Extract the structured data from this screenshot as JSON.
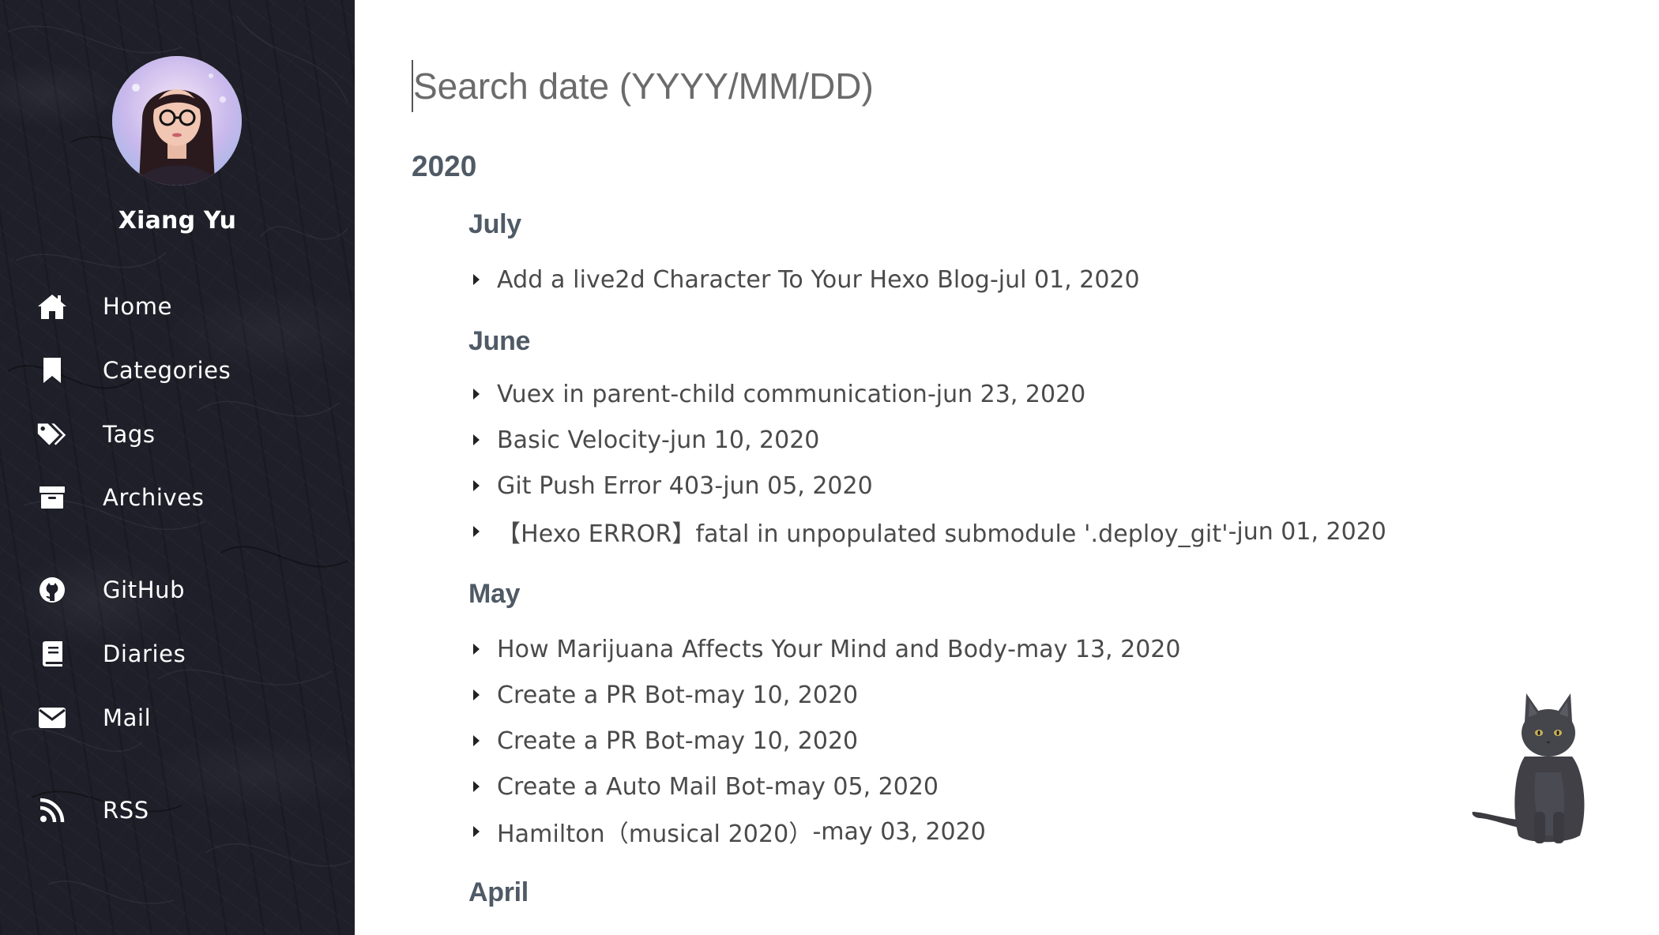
{
  "sidebar": {
    "author": "Xiang Yu",
    "nav": [
      {
        "label": "Home",
        "icon": "home-icon"
      },
      {
        "label": "Categories",
        "icon": "bookmark-icon"
      },
      {
        "label": "Tags",
        "icon": "tags-icon"
      },
      {
        "label": "Archives",
        "icon": "archive-icon"
      },
      {
        "label": "GitHub",
        "icon": "github-icon"
      },
      {
        "label": "Diaries",
        "icon": "book-icon"
      },
      {
        "label": "Mail",
        "icon": "mail-icon"
      },
      {
        "label": "RSS",
        "icon": "rss-icon"
      }
    ]
  },
  "search": {
    "placeholder": "Search date (YYYY/MM/DD)",
    "value": ""
  },
  "archive": {
    "year": "2020",
    "months": [
      {
        "name": "July",
        "posts": [
          {
            "title": "Add a live2d Character To Your Hexo Blog",
            "date": "jul 01, 2020"
          }
        ]
      },
      {
        "name": "June",
        "posts": [
          {
            "title": "Vuex in parent-child communication",
            "date": "jun 23, 2020"
          },
          {
            "title": "Basic Velocity",
            "date": "jun 10, 2020"
          },
          {
            "title": "Git Push Error 403",
            "date": "jun 05, 2020"
          },
          {
            "title": "【Hexo ERROR】fatal in unpopulated submodule '.deploy_git'",
            "date": "jun 01, 2020"
          }
        ]
      },
      {
        "name": "May",
        "posts": [
          {
            "title": "How Marijuana Affects Your Mind and Body",
            "date": "may 13, 2020"
          },
          {
            "title": "Create a PR Bot",
            "date": "may 10, 2020"
          },
          {
            "title": "Create a PR Bot",
            "date": "may 10, 2020"
          },
          {
            "title": "Create a Auto Mail Bot",
            "date": "may 05, 2020"
          },
          {
            "title": "Hamilton（musical 2020）",
            "date": "may 03, 2020"
          }
        ]
      },
      {
        "name": "April",
        "posts": []
      }
    ]
  },
  "separator": " - ",
  "colors": {
    "sidebar_bg": "#1e1f28",
    "heading": "#4f5a66",
    "text": "#4a4a4a"
  }
}
